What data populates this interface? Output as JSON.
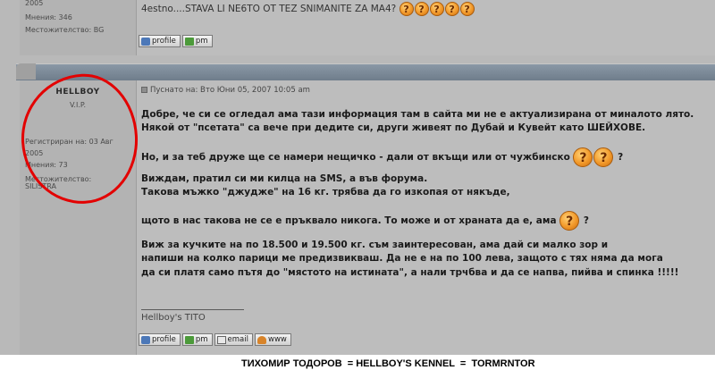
{
  "previous_post": {
    "year": "2005",
    "posts": "Мнения: 346",
    "location": "Местожителство: BG",
    "text": "4estno....STAVA LI NE6TO OT TEZ SNIMANITE ZA MA4?",
    "buttons": {
      "profile": "profile",
      "pm": "pm"
    }
  },
  "author": {
    "name": "HELLBOY",
    "rank": "V.I.P.",
    "registered": "Регистриран на: 03 Авг 2005",
    "posts": "Мнения: 73",
    "location_label": "Местожителство:",
    "location": "SILISTRA"
  },
  "post": {
    "header": "Пуснато на: Вто Юни 05, 2007 10:05 am",
    "lines": [
      "Добре, че си се огледал ама тази информация там в сайта ми не е актуализирана от миналото лято.",
      "Някой от \"псетата\" са вече при дедите си, други живеят по Дубай и Кувейт като ШЕЙХОВЕ.",
      "Но, и за теб друже ще се намери нещичко - дали от вкъщи или от чужбинско",
      "Виждам, пратил си ми килца на SMS, а във форума.",
      "Такова мъжко \"джудже\" на 16 кг. трябва да го изкопая от някъде,",
      "щото в нас такова не се е пръквало никога. То може и от храната да е, ама",
      "Виж за кучките на по 18.500 и 19.500 кг. съм заинтересован, ама дай си малко зор и",
      "напиши на колко парици ме предизвикваш. Да не е на по 100 лева, защото с тях няма да мога",
      "да си платя само пътя до \"мястото на истината\", а нали трчбва и да се напва, пийва и спинка !!!!!"
    ],
    "qmark": "?",
    "signature": "Hellboy's TITO",
    "buttons": {
      "profile": "profile",
      "pm": "pm",
      "email": "email",
      "www": "www"
    }
  },
  "caption": "ТИХОМИР ТОДОРОВ  = HELLBOY'S KENNEL  =  TORMRNTOR",
  "colors": {
    "circle": "#e30000",
    "bar": "#6f7d8b",
    "background": "#b9b9b9"
  }
}
